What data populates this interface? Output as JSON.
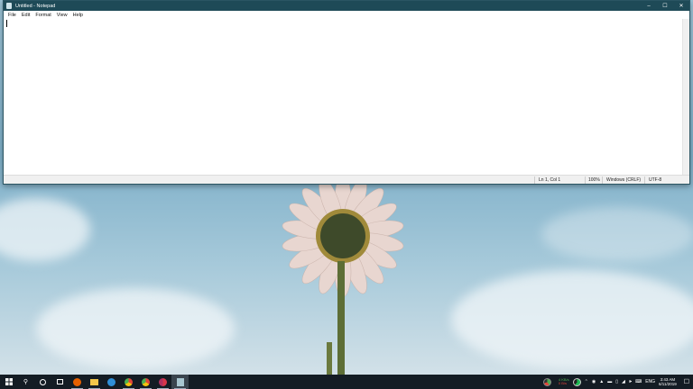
{
  "window": {
    "title": "Untitled - Notepad",
    "minimize": "–",
    "maximize": "☐",
    "close": "✕"
  },
  "menu": [
    "File",
    "Edit",
    "Format",
    "View",
    "Help"
  ],
  "editor": {
    "content": ""
  },
  "status": {
    "position": "Ln 1, Col 1",
    "zoom": "100%",
    "line_ending": "Windows (CRLF)",
    "encoding": "UTF-8"
  },
  "tray": {
    "net_up": "4 KB/s",
    "net_down": "0 B/s",
    "language": "ENG",
    "time": "3:43 AM",
    "date": "6/11/2019"
  },
  "taskbar_apps": [
    {
      "name": "firefox",
      "color": "#e66000"
    },
    {
      "name": "file-explorer",
      "color": "#f3c64a"
    },
    {
      "name": "app-blue",
      "color": "#2f8fd8"
    },
    {
      "name": "chrome-1",
      "color": "#4caf50"
    },
    {
      "name": "chrome-2",
      "color": "#e0463a"
    },
    {
      "name": "chrome-3",
      "color": "#d9364a"
    },
    {
      "name": "notepad",
      "color": "#a8c6d0"
    }
  ]
}
